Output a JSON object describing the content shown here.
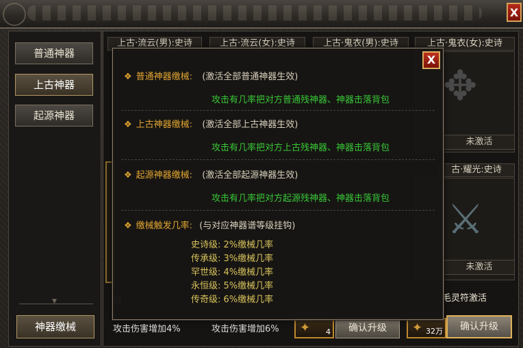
{
  "window": {
    "close_label": "X"
  },
  "nav": {
    "items": [
      {
        "label": "普通神器",
        "active": false
      },
      {
        "label": "上古神器",
        "active": true
      },
      {
        "label": "起源神器",
        "active": false
      }
    ],
    "bottom_button": "神器缴械"
  },
  "cards": {
    "headers": [
      "上古·流云(男):史诗",
      "上古·流云(女):史诗",
      "上古·鬼衣(男):史诗",
      "上古·鬼衣(女):史诗",
      "古·耀光:史诗"
    ],
    "status_1": "未激活",
    "status_2": "未激活"
  },
  "bottom": {
    "bonus_1": "攻击伤害增加4%",
    "bonus_2": "攻击伤害增加6%",
    "slot_1_count": "4",
    "slot_2_count": "32万",
    "confirm_1": "确认升级",
    "confirm_2": "确认升级",
    "activate_text": "毛灵符激活",
    "left_partial": "当"
  },
  "popup": {
    "close_label": "X",
    "sections": [
      {
        "name": "普通神器缴械:",
        "note": "(激活全部普通神器生效)",
        "effect": "攻击有几率把对方普通残神器、神器击落背包"
      },
      {
        "name": "上古神器缴械:",
        "note": "(激活全部上古神器生效)",
        "effect": "攻击有几率把对方上古残神器、神器击落背包"
      },
      {
        "name": "起源神器缴械:",
        "note": "(激活全部起源神器生效)",
        "effect": "攻击有几率把对方起源残神器、神器击落背包"
      }
    ],
    "trigger": {
      "name": "缴械触发几率:",
      "note": "(与对应神器谱等级挂钩)",
      "levels": [
        "史诗级: 2%缴械几率",
        "传承级: 3%缴械几率",
        "罕世级: 4%缴械几率",
        "永恒级: 5%缴械几率",
        "传奇级: 6%缴械几率"
      ]
    }
  },
  "colors": {
    "accent_gold": "#e0a531",
    "effect_green": "#37c837",
    "level_yellow": "#d8c35c",
    "close_red": "#c0321f"
  }
}
